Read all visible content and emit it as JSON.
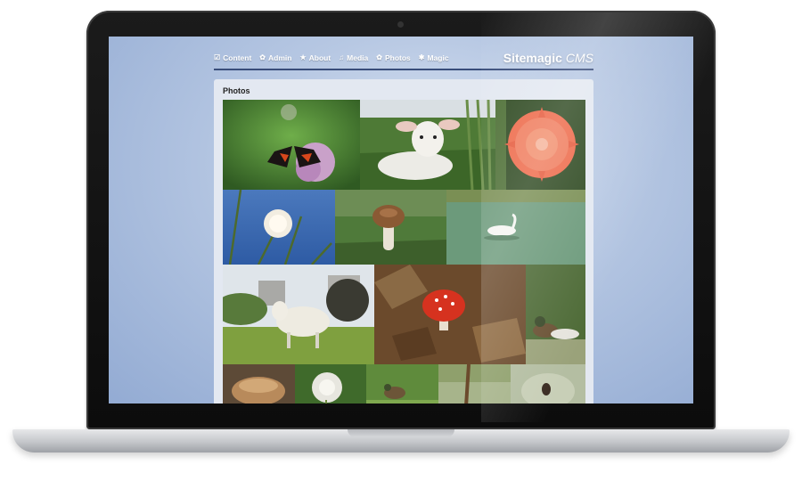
{
  "site": {
    "brand": "Sitemagic",
    "brand_suffix": "CMS",
    "menu": [
      {
        "icon": "checkbox-icon",
        "glyph": "☑",
        "label": "Content"
      },
      {
        "icon": "gear-icon",
        "glyph": "✿",
        "label": "Admin"
      },
      {
        "icon": "star-icon",
        "glyph": "★",
        "label": "About"
      },
      {
        "icon": "music-note-icon",
        "glyph": "♫",
        "label": "Media"
      },
      {
        "icon": "flower-icon",
        "glyph": "✿",
        "label": "Photos"
      },
      {
        "icon": "sparkle-icon",
        "glyph": "✱",
        "label": "Magic"
      }
    ]
  },
  "page": {
    "title": "Photos",
    "photos": [
      "butterfly",
      "lamb",
      "dahlia",
      "dandelion",
      "mushroom",
      "swan",
      "sheep",
      "fly-agaric",
      "ducks",
      "bracket-fungus",
      "dandelion-clock",
      "duck-grass",
      "stem",
      "beetle"
    ]
  },
  "colors": {
    "accent_line": "#394d7a",
    "panel_bg": "#e3e8f1",
    "screen_bg": "#b7c8e3"
  }
}
